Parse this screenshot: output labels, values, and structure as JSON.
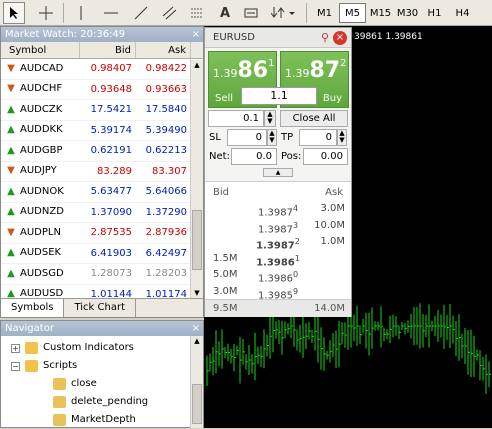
{
  "toolbar": {
    "timeframes": [
      "M1",
      "M5",
      "M15",
      "M30",
      "H1",
      "H4"
    ],
    "active": "M5",
    "tools": [
      "cursor",
      "crosshair",
      "vertical-line",
      "horizontal-line",
      "trendline",
      "channel",
      "fibonacci",
      "text",
      "arrows"
    ]
  },
  "market_watch": {
    "title": "Market Watch: 20:36:49",
    "columns": [
      "Symbol",
      "Bid",
      "Ask"
    ],
    "rows": [
      {
        "symbol": "AUDCAD",
        "bid": "0.98407",
        "ask": "0.98422",
        "dir": "down",
        "color": "red"
      },
      {
        "symbol": "AUDCHF",
        "bid": "0.93648",
        "ask": "0.93663",
        "dir": "down",
        "color": "red"
      },
      {
        "symbol": "AUDCZK",
        "bid": "17.5421",
        "ask": "17.5840",
        "dir": "up",
        "color": "blue"
      },
      {
        "symbol": "AUDDKK",
        "bid": "5.39174",
        "ask": "5.39490",
        "dir": "up",
        "color": "blue"
      },
      {
        "symbol": "AUDGBP",
        "bid": "0.62191",
        "ask": "0.62213",
        "dir": "up",
        "color": "blue"
      },
      {
        "symbol": "AUDJPY",
        "bid": "83.289",
        "ask": "83.307",
        "dir": "down",
        "color": "red"
      },
      {
        "symbol": "AUDNOK",
        "bid": "5.63477",
        "ask": "5.64066",
        "dir": "up",
        "color": "blue"
      },
      {
        "symbol": "AUDNZD",
        "bid": "1.37090",
        "ask": "1.37290",
        "dir": "up",
        "color": "blue"
      },
      {
        "symbol": "AUDPLN",
        "bid": "2.87535",
        "ask": "2.87936",
        "dir": "down",
        "color": "red"
      },
      {
        "symbol": "AUDSEK",
        "bid": "6.41903",
        "ask": "6.42497",
        "dir": "up",
        "color": "blue"
      },
      {
        "symbol": "AUDSGD",
        "bid": "1.28073",
        "ask": "1.28203",
        "dir": "up",
        "color": "grey"
      },
      {
        "symbol": "AUDUSD",
        "bid": "1.01144",
        "ask": "1.01174",
        "dir": "up",
        "color": "blue"
      }
    ],
    "tabs": [
      "Symbols",
      "Tick Chart"
    ]
  },
  "navigator": {
    "title": "Navigator",
    "items": [
      "Custom Indicators",
      "Scripts",
      "close",
      "delete_pending",
      "MarketDepth"
    ]
  },
  "chart": {
    "price_label": "39861 1.39861"
  },
  "oct": {
    "symbol": "EURUSD",
    "sell": {
      "pre": "1.39",
      "big": "86",
      "sup": "1",
      "label": "Sell"
    },
    "buy": {
      "pre": "1.39",
      "big": "87",
      "sup": "2",
      "label": "Buy"
    },
    "lot": "1.1",
    "volume": "0.1",
    "close_all": "Close All",
    "sl_label": "SL",
    "sl": "0",
    "tp_label": "TP",
    "tp": "0",
    "net_label": "Net:",
    "net": "0.0",
    "pos_label": "Pos:",
    "pos": "0.00",
    "depth": {
      "bid_label": "Bid",
      "ask_label": "Ask",
      "rows": [
        {
          "price": "1.3987",
          "sup": "4",
          "bid_vol": "",
          "ask_vol": "3.0M"
        },
        {
          "price": "1.3987",
          "sup": "3",
          "bid_vol": "",
          "ask_vol": "10.0M"
        },
        {
          "price": "1.3987",
          "sup": "2",
          "bid_vol": "",
          "ask_vol": "1.0M",
          "bold": true
        },
        {
          "price": "1.3986",
          "sup": "1",
          "bid_vol": "1.5M",
          "ask_vol": "",
          "bold": true
        },
        {
          "price": "1.3986",
          "sup": "0",
          "bid_vol": "5.0M",
          "ask_vol": ""
        },
        {
          "price": "1.3985",
          "sup": "9",
          "bid_vol": "3.0M",
          "ask_vol": ""
        }
      ],
      "total_bid": "9.5M",
      "total_ask": "14.0M"
    }
  }
}
